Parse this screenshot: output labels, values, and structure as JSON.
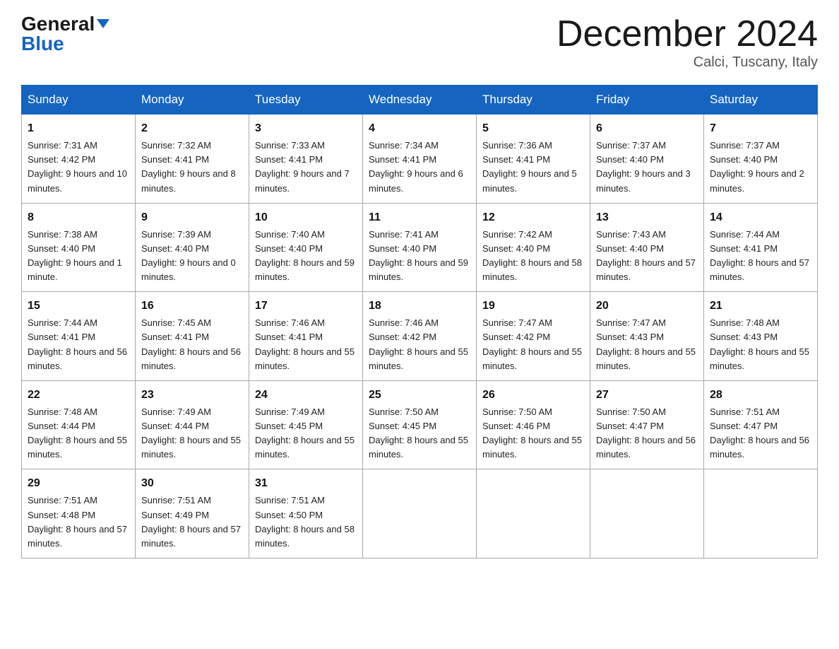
{
  "header": {
    "logo_general": "General",
    "logo_blue": "Blue",
    "month_title": "December 2024",
    "subtitle": "Calci, Tuscany, Italy"
  },
  "days_of_week": [
    "Sunday",
    "Monday",
    "Tuesday",
    "Wednesday",
    "Thursday",
    "Friday",
    "Saturday"
  ],
  "weeks": [
    [
      {
        "day": "1",
        "sunrise": "7:31 AM",
        "sunset": "4:42 PM",
        "daylight": "9 hours and 10 minutes."
      },
      {
        "day": "2",
        "sunrise": "7:32 AM",
        "sunset": "4:41 PM",
        "daylight": "9 hours and 8 minutes."
      },
      {
        "day": "3",
        "sunrise": "7:33 AM",
        "sunset": "4:41 PM",
        "daylight": "9 hours and 7 minutes."
      },
      {
        "day": "4",
        "sunrise": "7:34 AM",
        "sunset": "4:41 PM",
        "daylight": "9 hours and 6 minutes."
      },
      {
        "day": "5",
        "sunrise": "7:36 AM",
        "sunset": "4:41 PM",
        "daylight": "9 hours and 5 minutes."
      },
      {
        "day": "6",
        "sunrise": "7:37 AM",
        "sunset": "4:40 PM",
        "daylight": "9 hours and 3 minutes."
      },
      {
        "day": "7",
        "sunrise": "7:37 AM",
        "sunset": "4:40 PM",
        "daylight": "9 hours and 2 minutes."
      }
    ],
    [
      {
        "day": "8",
        "sunrise": "7:38 AM",
        "sunset": "4:40 PM",
        "daylight": "9 hours and 1 minute."
      },
      {
        "day": "9",
        "sunrise": "7:39 AM",
        "sunset": "4:40 PM",
        "daylight": "9 hours and 0 minutes."
      },
      {
        "day": "10",
        "sunrise": "7:40 AM",
        "sunset": "4:40 PM",
        "daylight": "8 hours and 59 minutes."
      },
      {
        "day": "11",
        "sunrise": "7:41 AM",
        "sunset": "4:40 PM",
        "daylight": "8 hours and 59 minutes."
      },
      {
        "day": "12",
        "sunrise": "7:42 AM",
        "sunset": "4:40 PM",
        "daylight": "8 hours and 58 minutes."
      },
      {
        "day": "13",
        "sunrise": "7:43 AM",
        "sunset": "4:40 PM",
        "daylight": "8 hours and 57 minutes."
      },
      {
        "day": "14",
        "sunrise": "7:44 AM",
        "sunset": "4:41 PM",
        "daylight": "8 hours and 57 minutes."
      }
    ],
    [
      {
        "day": "15",
        "sunrise": "7:44 AM",
        "sunset": "4:41 PM",
        "daylight": "8 hours and 56 minutes."
      },
      {
        "day": "16",
        "sunrise": "7:45 AM",
        "sunset": "4:41 PM",
        "daylight": "8 hours and 56 minutes."
      },
      {
        "day": "17",
        "sunrise": "7:46 AM",
        "sunset": "4:41 PM",
        "daylight": "8 hours and 55 minutes."
      },
      {
        "day": "18",
        "sunrise": "7:46 AM",
        "sunset": "4:42 PM",
        "daylight": "8 hours and 55 minutes."
      },
      {
        "day": "19",
        "sunrise": "7:47 AM",
        "sunset": "4:42 PM",
        "daylight": "8 hours and 55 minutes."
      },
      {
        "day": "20",
        "sunrise": "7:47 AM",
        "sunset": "4:43 PM",
        "daylight": "8 hours and 55 minutes."
      },
      {
        "day": "21",
        "sunrise": "7:48 AM",
        "sunset": "4:43 PM",
        "daylight": "8 hours and 55 minutes."
      }
    ],
    [
      {
        "day": "22",
        "sunrise": "7:48 AM",
        "sunset": "4:44 PM",
        "daylight": "8 hours and 55 minutes."
      },
      {
        "day": "23",
        "sunrise": "7:49 AM",
        "sunset": "4:44 PM",
        "daylight": "8 hours and 55 minutes."
      },
      {
        "day": "24",
        "sunrise": "7:49 AM",
        "sunset": "4:45 PM",
        "daylight": "8 hours and 55 minutes."
      },
      {
        "day": "25",
        "sunrise": "7:50 AM",
        "sunset": "4:45 PM",
        "daylight": "8 hours and 55 minutes."
      },
      {
        "day": "26",
        "sunrise": "7:50 AM",
        "sunset": "4:46 PM",
        "daylight": "8 hours and 55 minutes."
      },
      {
        "day": "27",
        "sunrise": "7:50 AM",
        "sunset": "4:47 PM",
        "daylight": "8 hours and 56 minutes."
      },
      {
        "day": "28",
        "sunrise": "7:51 AM",
        "sunset": "4:47 PM",
        "daylight": "8 hours and 56 minutes."
      }
    ],
    [
      {
        "day": "29",
        "sunrise": "7:51 AM",
        "sunset": "4:48 PM",
        "daylight": "8 hours and 57 minutes."
      },
      {
        "day": "30",
        "sunrise": "7:51 AM",
        "sunset": "4:49 PM",
        "daylight": "8 hours and 57 minutes."
      },
      {
        "day": "31",
        "sunrise": "7:51 AM",
        "sunset": "4:50 PM",
        "daylight": "8 hours and 58 minutes."
      },
      null,
      null,
      null,
      null
    ]
  ]
}
